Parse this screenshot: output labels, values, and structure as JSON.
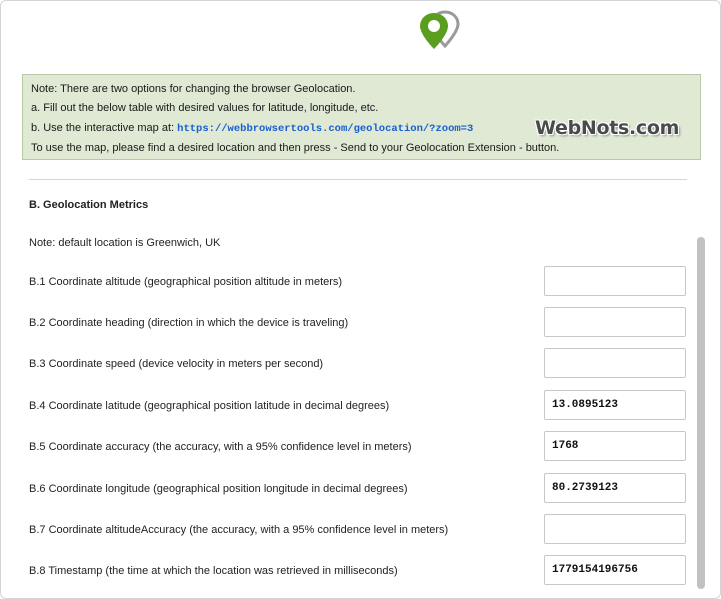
{
  "note": {
    "line1": "Note: There are two options for changing the browser Geolocation.",
    "line2": "a. Fill out the below table with desired values for latitude, longitude, etc.",
    "line3_prefix": "b. Use the interactive map at: ",
    "line3_link": "https://webbrowsertools.com/geolocation/?zoom=3",
    "line4": "To use the map, please find a desired location and then press - Send to your Geolocation Extension - button."
  },
  "watermark": "WebNots.com",
  "logo": {
    "icon": "map-pin-icon",
    "colors": {
      "primary": "#5a9e1f",
      "secondary": "#9a9a9a"
    }
  },
  "section": {
    "title": "B. Geolocation Metrics",
    "default_note": "Note: default location is Greenwich, UK"
  },
  "rows": [
    {
      "label": "B.1 Coordinate altitude (geographical position altitude in meters)",
      "value": ""
    },
    {
      "label": "B.2 Coordinate heading (direction in which the device is traveling)",
      "value": ""
    },
    {
      "label": "B.3 Coordinate speed (device velocity in meters per second)",
      "value": ""
    },
    {
      "label": "B.4 Coordinate latitude (geographical position latitude in decimal degrees)",
      "value": "13.0895123"
    },
    {
      "label": "B.5 Coordinate accuracy (the accuracy, with a 95% confidence level in meters)",
      "value": "1768"
    },
    {
      "label": "B.6 Coordinate longitude (geographical position longitude in decimal degrees)",
      "value": "80.2739123"
    },
    {
      "label": "B.7 Coordinate altitudeAccuracy (the accuracy, with a 95% confidence level in meters)",
      "value": ""
    },
    {
      "label": "B.8 Timestamp (the time at which the location was retrieved in milliseconds)",
      "value": "1779154196756"
    }
  ]
}
